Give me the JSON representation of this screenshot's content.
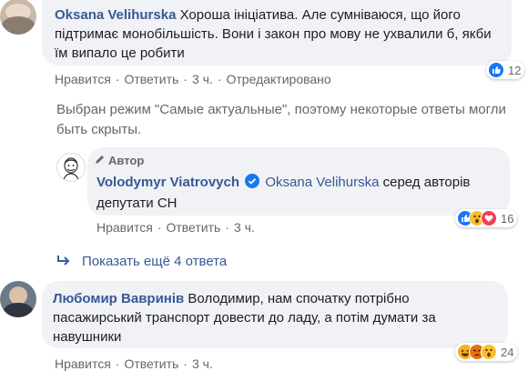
{
  "comments": [
    {
      "author": "Oksana Velihurska",
      "text": "Хороша ініціатива. Але сумніваюся, що його підтримає монобільшість. Вони і закон про мову не ухвалили б, якби їм випало це робити",
      "actions": {
        "like": "Нравится",
        "reply": "Ответить",
        "time": "3 ч.",
        "edited": "Отредактировано"
      },
      "reactions": {
        "icons": [
          "like-icon"
        ],
        "count": "12"
      }
    }
  ],
  "notice": "Выбран режим \"Самые актуальные\", поэтому некоторые ответы могли быть скрыты.",
  "reply": {
    "badge": "Автор",
    "author": "Volodymyr Viatrovych",
    "mention": "Oksana Velihurska",
    "text": "серед авторів депутати СН",
    "actions": {
      "like": "Нравится",
      "reply": "Ответить",
      "time": "3 ч."
    },
    "reactions": {
      "icons": [
        "like-icon",
        "wow-icon",
        "love-icon"
      ],
      "count": "16"
    }
  },
  "show_more": "Показать ещё 4 ответа",
  "comment2": {
    "author": "Любомир Вавринів",
    "text": "Володимир, нам спочатку потрібно пасажирський транспорт довести до ладу, а потім думати за навушники",
    "actions": {
      "like": "Нравится",
      "reply": "Ответить",
      "time": "3 ч."
    },
    "reactions": {
      "icons": [
        "haha-icon",
        "angry-icon",
        "wow-icon"
      ],
      "count": "24"
    }
  },
  "colors": {
    "link": "#385898",
    "bubble": "#f0f2f5",
    "meta": "#65676b",
    "like_blue": "#1877f2",
    "verified": "#1877f2"
  }
}
